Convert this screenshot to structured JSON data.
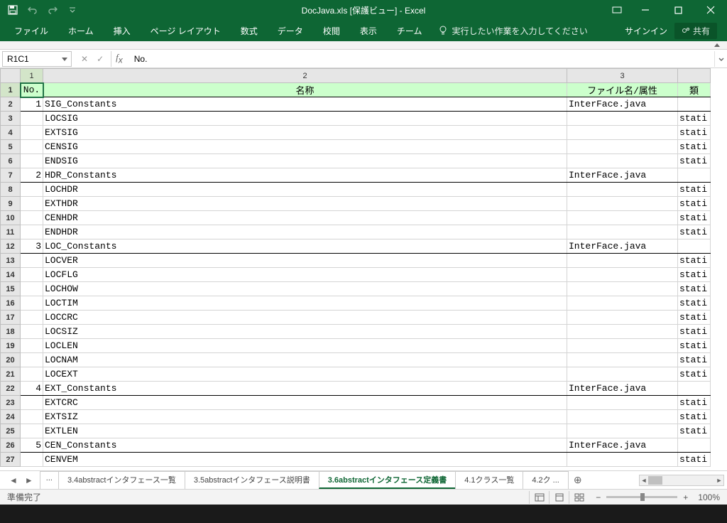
{
  "title": "DocJava.xls  [保護ビュー] - Excel",
  "ribbon": {
    "tabs": [
      "ファイル",
      "ホーム",
      "挿入",
      "ページ レイアウト",
      "数式",
      "データ",
      "校閲",
      "表示",
      "チーム"
    ],
    "tellme": "実行したい作業を入力してください",
    "signin": "サインイン",
    "share": "共有"
  },
  "namebox": "R1C1",
  "formula": "No.",
  "colHeaders": [
    "1",
    "2",
    "3"
  ],
  "tableHeaders": {
    "no": "No.",
    "name": "名称",
    "file": "ファイル名/属性"
  },
  "rows": [
    {
      "r": 2,
      "no": "1",
      "name": "SIG_Constants",
      "file": "InterFace.java",
      "attr": "",
      "sec": true
    },
    {
      "r": 3,
      "no": "",
      "name": "LOCSIG",
      "file": "",
      "attr": "stati"
    },
    {
      "r": 4,
      "no": "",
      "name": "EXTSIG",
      "file": "",
      "attr": "stati"
    },
    {
      "r": 5,
      "no": "",
      "name": "CENSIG",
      "file": "",
      "attr": "stati"
    },
    {
      "r": 6,
      "no": "",
      "name": "ENDSIG",
      "file": "",
      "attr": "stati"
    },
    {
      "r": 7,
      "no": "2",
      "name": "HDR_Constants",
      "file": "InterFace.java",
      "attr": "",
      "sec": true
    },
    {
      "r": 8,
      "no": "",
      "name": "LOCHDR",
      "file": "",
      "attr": "stati"
    },
    {
      "r": 9,
      "no": "",
      "name": "EXTHDR",
      "file": "",
      "attr": "stati"
    },
    {
      "r": 10,
      "no": "",
      "name": "CENHDR",
      "file": "",
      "attr": "stati"
    },
    {
      "r": 11,
      "no": "",
      "name": "ENDHDR",
      "file": "",
      "attr": "stati"
    },
    {
      "r": 12,
      "no": "3",
      "name": "LOC_Constants",
      "file": "InterFace.java",
      "attr": "",
      "sec": true
    },
    {
      "r": 13,
      "no": "",
      "name": "LOCVER",
      "file": "",
      "attr": "stati"
    },
    {
      "r": 14,
      "no": "",
      "name": "LOCFLG",
      "file": "",
      "attr": "stati"
    },
    {
      "r": 15,
      "no": "",
      "name": "LOCHOW",
      "file": "",
      "attr": "stati"
    },
    {
      "r": 16,
      "no": "",
      "name": "LOCTIM",
      "file": "",
      "attr": "stati"
    },
    {
      "r": 17,
      "no": "",
      "name": "LOCCRC",
      "file": "",
      "attr": "stati"
    },
    {
      "r": 18,
      "no": "",
      "name": "LOCSIZ",
      "file": "",
      "attr": "stati"
    },
    {
      "r": 19,
      "no": "",
      "name": "LOCLEN",
      "file": "",
      "attr": "stati"
    },
    {
      "r": 20,
      "no": "",
      "name": "LOCNAM",
      "file": "",
      "attr": "stati"
    },
    {
      "r": 21,
      "no": "",
      "name": "LOCEXT",
      "file": "",
      "attr": "stati"
    },
    {
      "r": 22,
      "no": "4",
      "name": "EXT_Constants",
      "file": "InterFace.java",
      "attr": "",
      "sec": true
    },
    {
      "r": 23,
      "no": "",
      "name": "EXTCRC",
      "file": "",
      "attr": "stati"
    },
    {
      "r": 24,
      "no": "",
      "name": "EXTSIZ",
      "file": "",
      "attr": "stati"
    },
    {
      "r": 25,
      "no": "",
      "name": "EXTLEN",
      "file": "",
      "attr": "stati"
    },
    {
      "r": 26,
      "no": "5",
      "name": "CEN_Constants",
      "file": "InterFace.java",
      "attr": "",
      "sec": true
    },
    {
      "r": 27,
      "no": "",
      "name": "CENVEM",
      "file": "",
      "attr": "stati"
    }
  ],
  "sheetTabs": [
    {
      "label": "...",
      "active": false
    },
    {
      "label": "3.4abstractインタフェース一覧",
      "active": false
    },
    {
      "label": "3.5abstractインタフェース説明書",
      "active": false
    },
    {
      "label": "3.6abstractインタフェース定義書",
      "active": true
    },
    {
      "label": "4.1クラス一覧",
      "active": false
    },
    {
      "label": "4.2ク ...",
      "active": false
    }
  ],
  "status": "準備完了",
  "zoom": "100%"
}
